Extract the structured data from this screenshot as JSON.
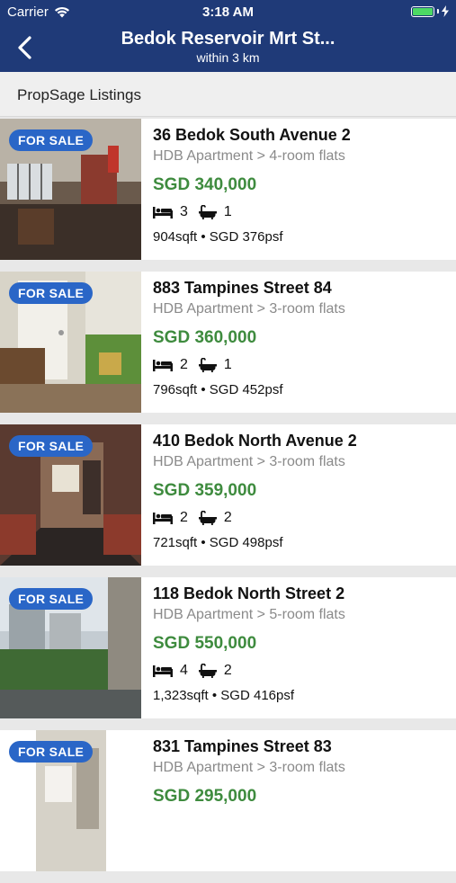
{
  "status_bar": {
    "carrier": "Carrier",
    "time": "3:18 AM"
  },
  "nav": {
    "title": "Bedok Reservoir Mrt St...",
    "subtitle": "within 3 km"
  },
  "section": {
    "title": "PropSage Listings"
  },
  "listings": [
    {
      "badge": "FOR SALE",
      "address": "36 Bedok South Avenue 2",
      "type": "HDB Apartment > 4-room flats",
      "price": "SGD 340,000",
      "beds": "3",
      "baths": "1",
      "size": "904sqft • SGD 376psf"
    },
    {
      "badge": "FOR SALE",
      "address": "883 Tampines Street 84",
      "type": "HDB Apartment > 3-room flats",
      "price": "SGD 360,000",
      "beds": "2",
      "baths": "1",
      "size": "796sqft • SGD 452psf"
    },
    {
      "badge": "FOR SALE",
      "address": "410 Bedok North Avenue 2",
      "type": "HDB Apartment > 3-room flats",
      "price": "SGD 359,000",
      "beds": "2",
      "baths": "2",
      "size": "721sqft • SGD 498psf"
    },
    {
      "badge": "FOR SALE",
      "address": "118 Bedok North Street 2",
      "type": "HDB Apartment > 5-room flats",
      "price": "SGD 550,000",
      "beds": "4",
      "baths": "2",
      "size": "1,323sqft • SGD 416psf"
    },
    {
      "badge": "FOR SALE",
      "address": "831 Tampines Street 83",
      "type": "HDB Apartment > 3-room flats",
      "price": "SGD 295,000",
      "beds": "",
      "baths": "",
      "size": ""
    }
  ]
}
